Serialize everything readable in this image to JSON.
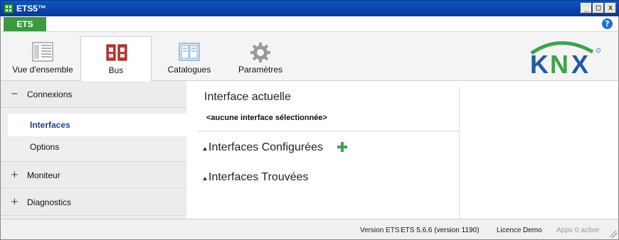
{
  "window": {
    "title": "ETS5™"
  },
  "menu": {
    "ets_tab": "ETS"
  },
  "ribbon": {
    "tabs": [
      {
        "label": "Vue d'ensemble",
        "icon": "overview-icon"
      },
      {
        "label": "Bus",
        "icon": "bus-icon",
        "active": true
      },
      {
        "label": "Catalogues",
        "icon": "catalog-icon"
      },
      {
        "label": "Paramètres",
        "icon": "gear-icon"
      }
    ],
    "logo": "KNX"
  },
  "nav": {
    "groups": [
      {
        "sign": "−",
        "label": "Connexions",
        "expanded": true
      },
      {
        "sign": "+",
        "label": "Moniteur"
      },
      {
        "sign": "+",
        "label": "Diagnostics"
      }
    ],
    "items": [
      {
        "label": "Interfaces",
        "selected": true
      },
      {
        "label": "Options"
      }
    ]
  },
  "main": {
    "current_title": "Interface actuelle",
    "current_value": "<aucune interface sélectionnée>",
    "configured_title": "Interfaces Configurées",
    "found_title": "Interfaces Trouvées"
  },
  "status": {
    "version_label": "Version ETS",
    "version_value": "ETS 5.6.6 (version 1190)",
    "license_label": "Licence",
    "license_value": "Demo",
    "apps_label": "Apps",
    "apps_value": "0 active"
  },
  "colors": {
    "accent_green": "#3a9a3f",
    "knx_green": "#3da34a",
    "knx_blue": "#1e5aa8",
    "titlebar_blue": "#0a45ae"
  }
}
